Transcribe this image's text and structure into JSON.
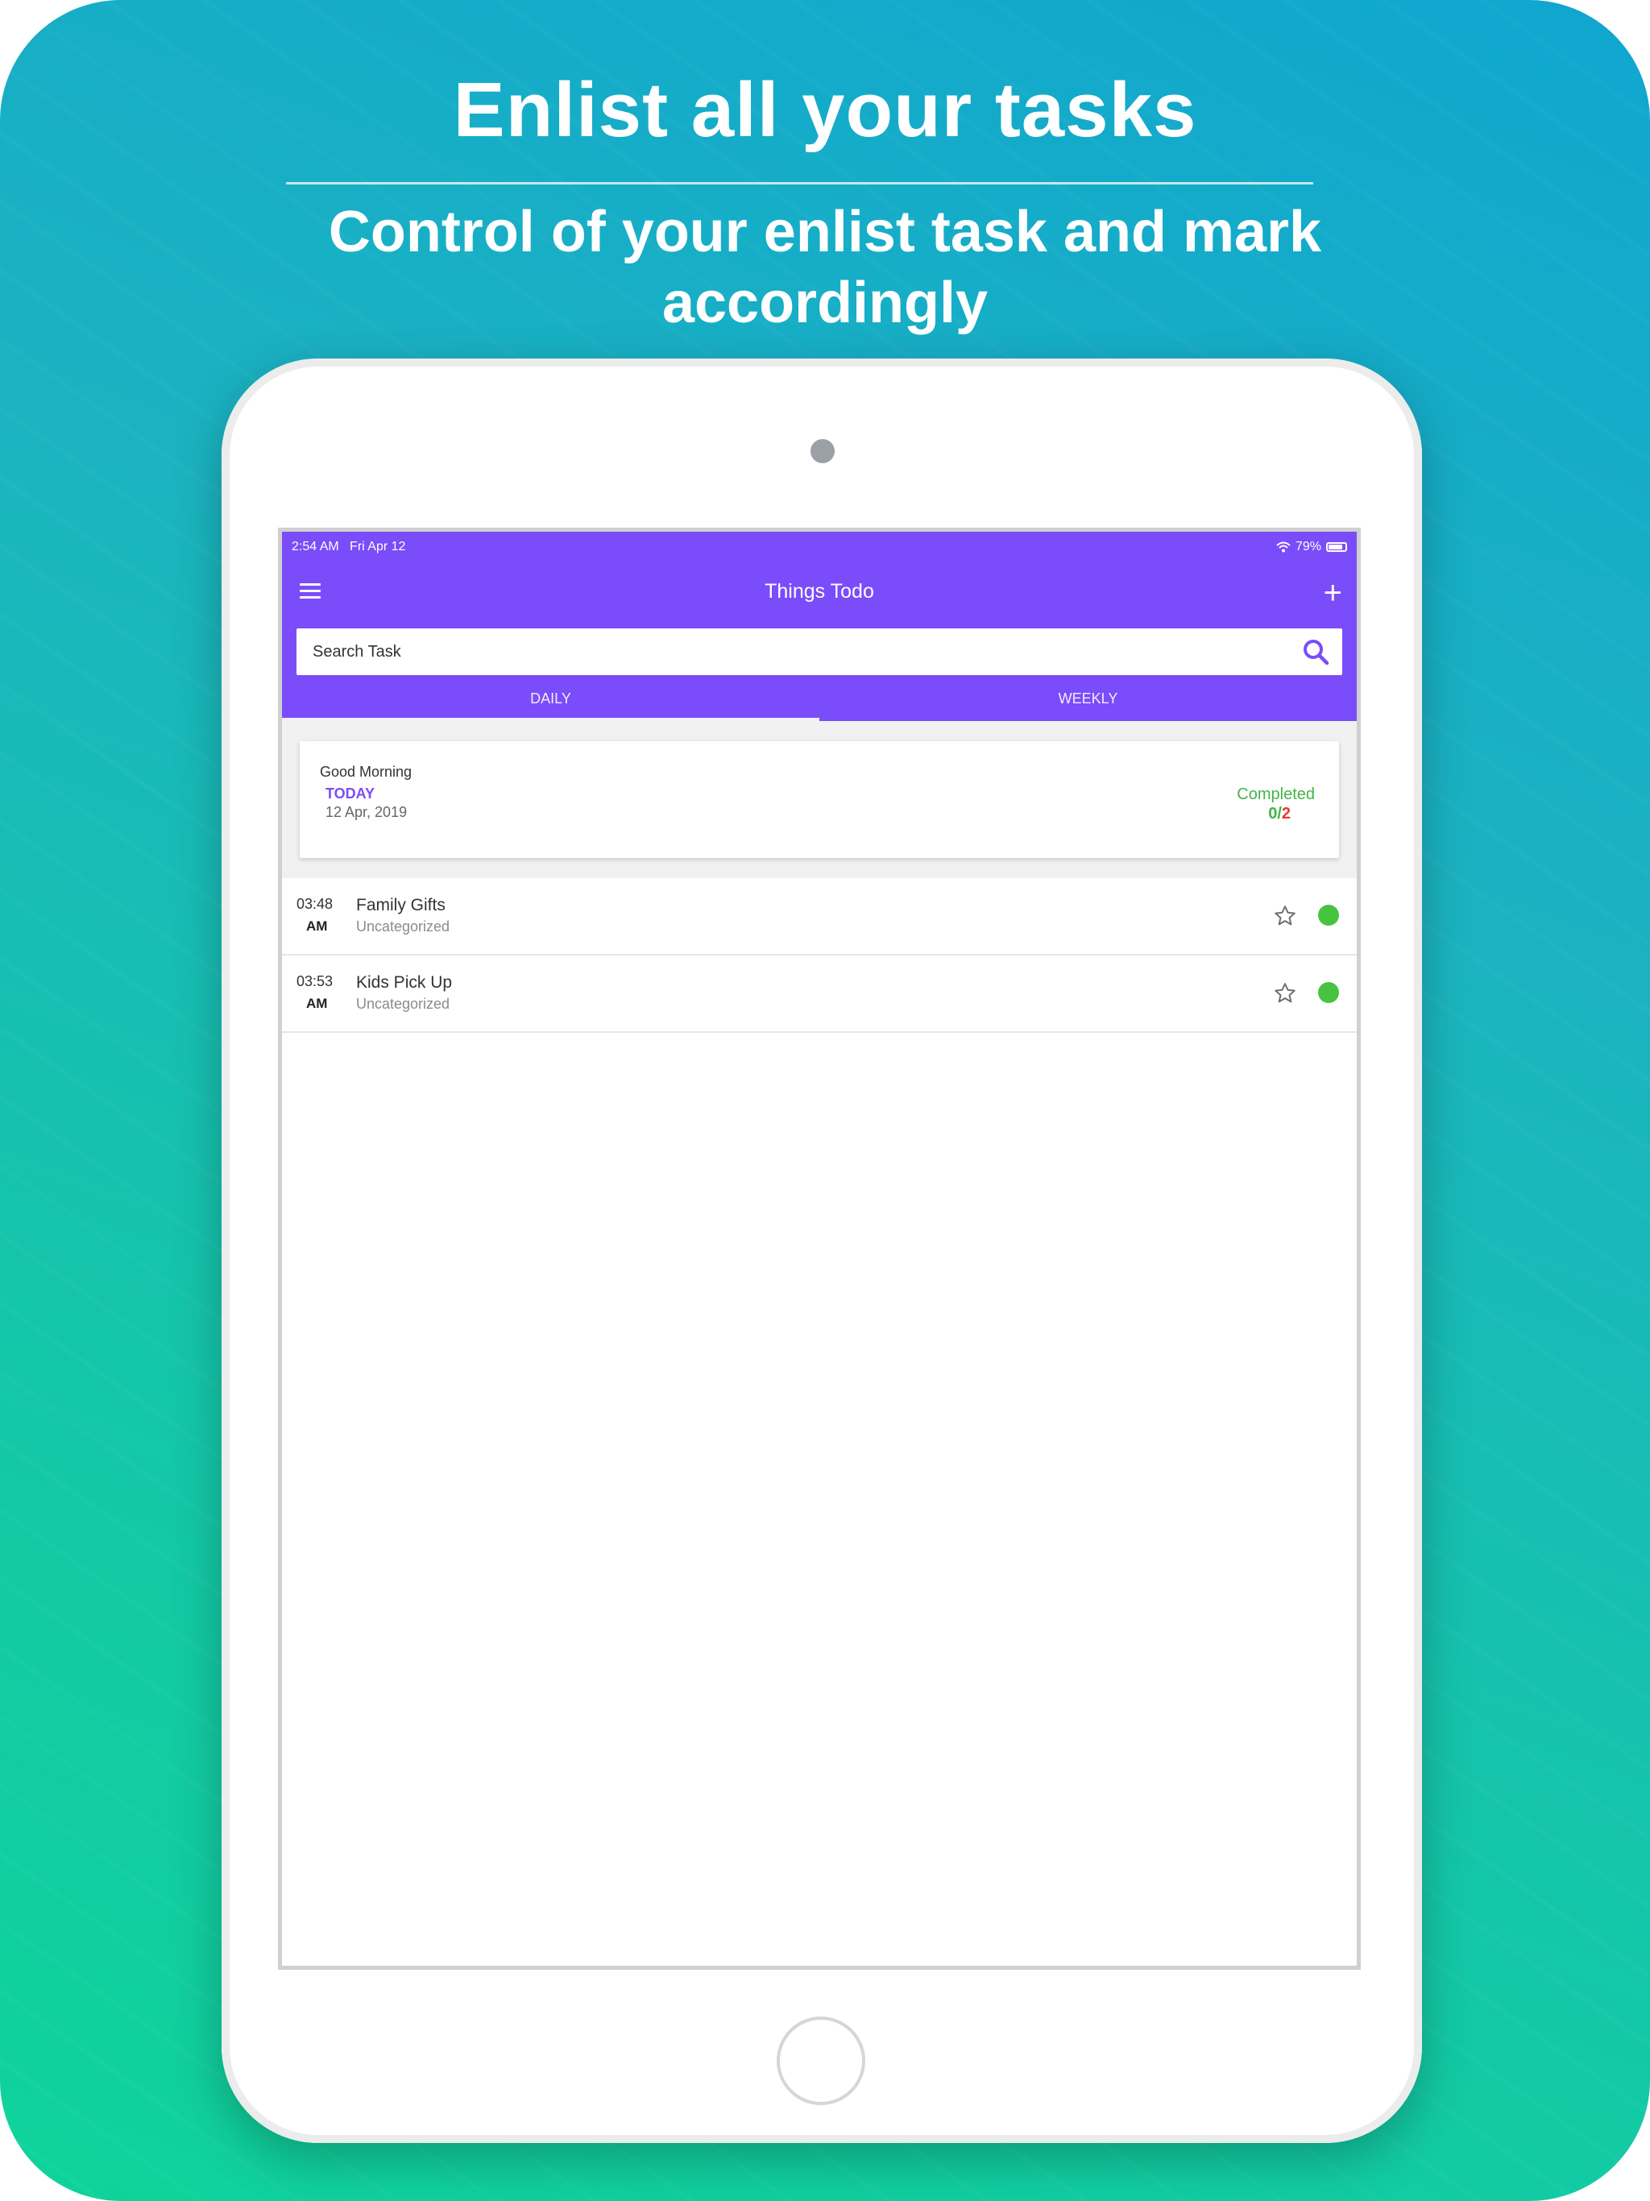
{
  "promo": {
    "headline": "Enlist all your tasks",
    "subline": "Control of your enlist task and mark accordingly"
  },
  "status_bar": {
    "time": "2:54 AM",
    "date": "Fri Apr 12",
    "battery": "79%"
  },
  "app": {
    "title": "Things Todo"
  },
  "search": {
    "placeholder": "Search Task"
  },
  "tabs": [
    {
      "label": "DAILY",
      "active": true
    },
    {
      "label": "WEEKLY",
      "active": false
    }
  ],
  "summary": {
    "greeting": "Good Morning",
    "day_label": "TODAY",
    "date": "12 Apr, 2019",
    "completed_label": "Completed",
    "completed_done": "0",
    "completed_separator": "/",
    "completed_total": "2"
  },
  "tasks": [
    {
      "time": "03:48",
      "ampm": "AM",
      "title": "Family Gifts",
      "category": "Uncategorized"
    },
    {
      "time": "03:53",
      "ampm": "AM",
      "title": "Kids Pick Up",
      "category": "Uncategorized"
    }
  ],
  "colors": {
    "primary": "#7b4cf9",
    "success": "#43b348",
    "danger": "#e53935",
    "status_dot": "#47c43f"
  },
  "icons": {
    "menu": "menu-icon",
    "add": "plus-icon",
    "search": "search-icon",
    "favorite": "star-icon",
    "wifi": "wifi-icon",
    "battery": "battery-icon"
  }
}
